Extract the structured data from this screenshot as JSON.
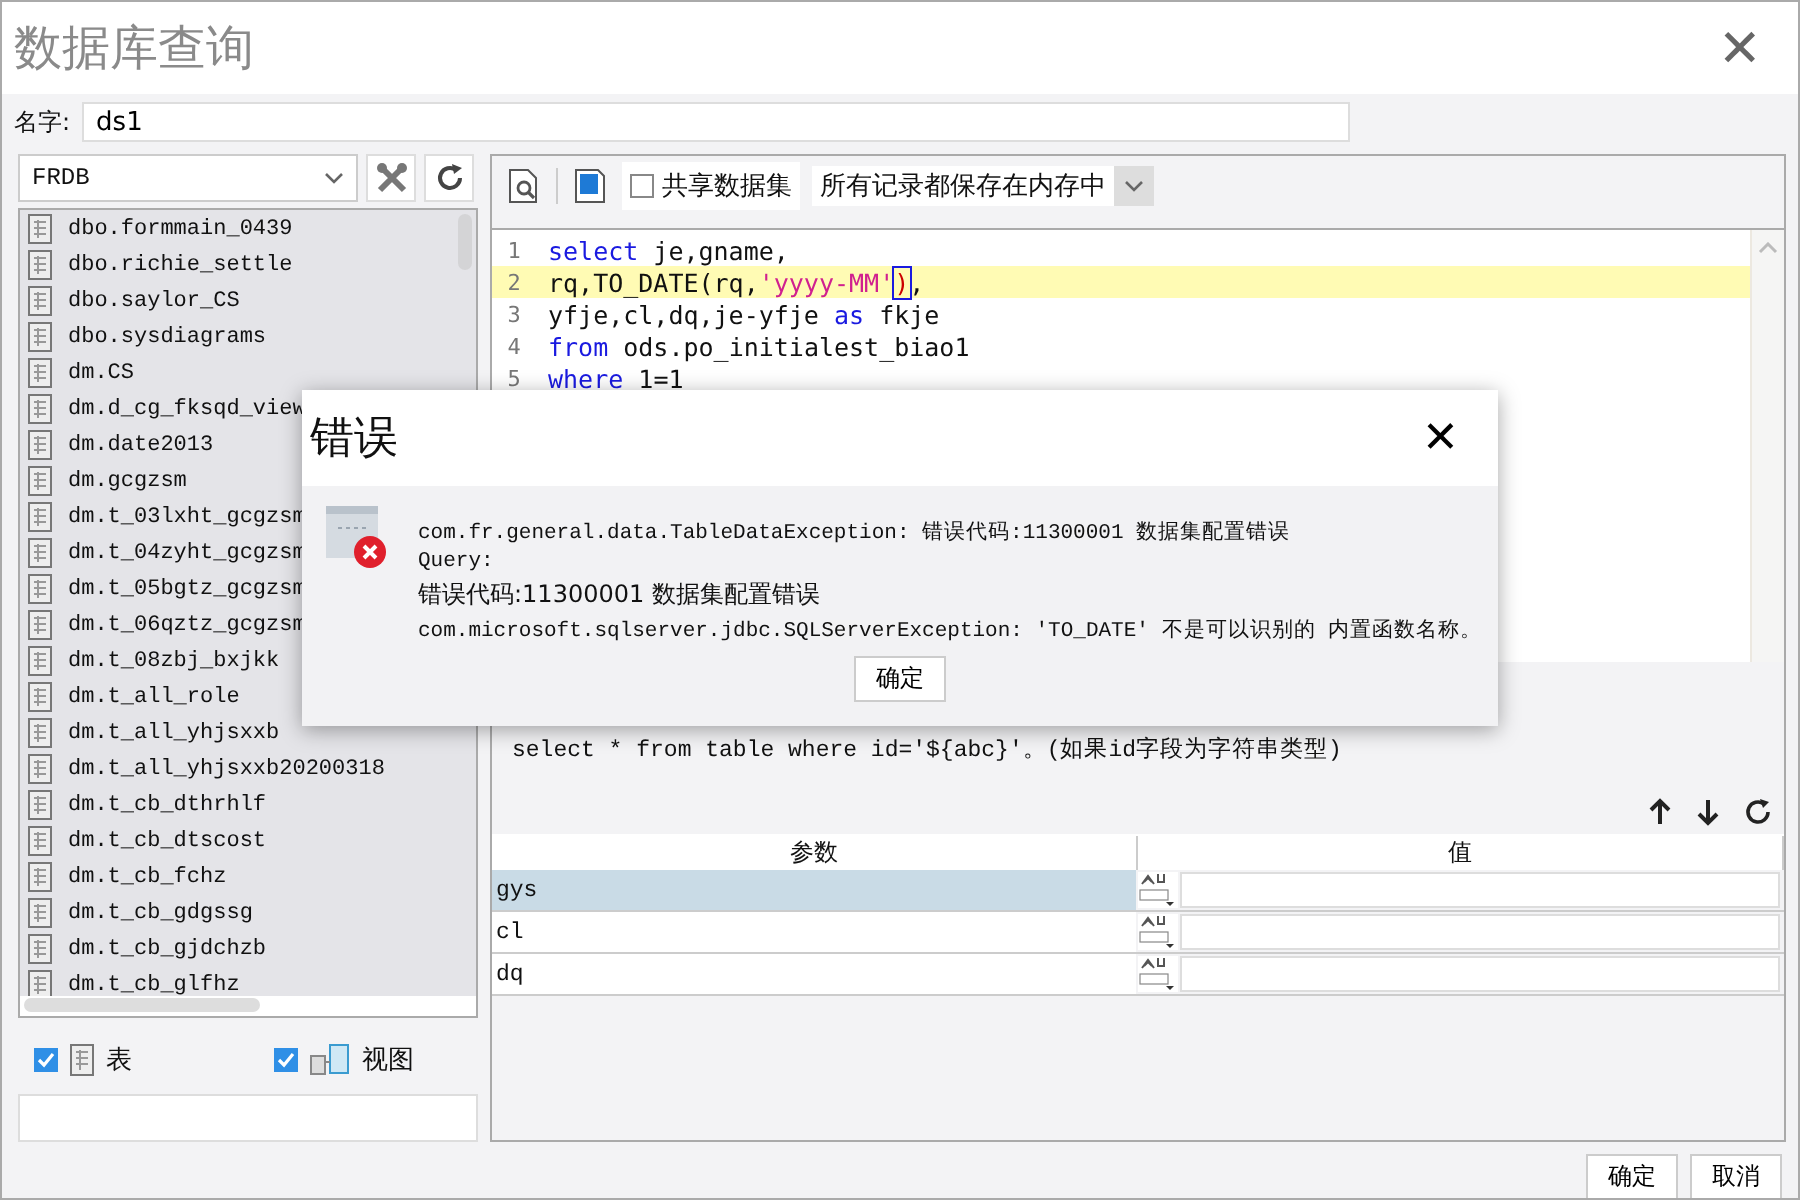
{
  "window": {
    "title": "数据库查询",
    "close": "✕"
  },
  "name_field": {
    "label": "名字:",
    "value": "ds1"
  },
  "connection": {
    "value": "FRDB"
  },
  "tables": [
    {
      "name": "dbo.formmain_0439"
    },
    {
      "name": "dbo.richie_settle"
    },
    {
      "name": "dbo.saylor_CS"
    },
    {
      "name": "dbo.sysdiagrams"
    },
    {
      "name": "dm.CS"
    },
    {
      "name": "dm.d_cg_fksqd_view"
    },
    {
      "name": "dm.date2013"
    },
    {
      "name": "dm.gcgzsm"
    },
    {
      "name": "dm.t_03lxht_gcgzsm"
    },
    {
      "name": "dm.t_04zyht_gcgzsm"
    },
    {
      "name": "dm.t_05bgtz_gcgzsm"
    },
    {
      "name": "dm.t_06qztz_gcgzsm"
    },
    {
      "name": "dm.t_08zbj_bxjkk"
    },
    {
      "name": "dm.t_all_role"
    },
    {
      "name": "dm.t_all_yhjsxxb"
    },
    {
      "name": "dm.t_all_yhjsxxb20200318"
    },
    {
      "name": "dm.t_cb_dthrhlf"
    },
    {
      "name": "dm.t_cb_dtscost"
    },
    {
      "name": "dm.t_cb_fchz"
    },
    {
      "name": "dm.t_cb_gdgssg"
    },
    {
      "name": "dm.t_cb_gjdchzb"
    },
    {
      "name": "dm.t_cb_glfhz"
    }
  ],
  "filters": [
    {
      "label": "表",
      "checked": true,
      "kind": "table"
    },
    {
      "label": "视图",
      "checked": true,
      "kind": "view"
    }
  ],
  "toolbar": {
    "share": {
      "label": "共享数据集",
      "checked": false
    },
    "storage": "所有记录都保存在内存中"
  },
  "editor": {
    "lines": [
      {
        "number": "1",
        "current": false,
        "tokens": [
          {
            "text": "select",
            "kind": "keyword"
          },
          {
            "text": " je,gname,",
            "kind": "plain"
          }
        ]
      },
      {
        "number": "2",
        "current": true,
        "tokens": [
          {
            "text": "rq,TO_DATE(rq,",
            "kind": "plain"
          },
          {
            "text": "'yyyy-MM'",
            "kind": "string"
          },
          {
            "text": ")",
            "kind": "bracket"
          },
          {
            "text": ",",
            "kind": "plain"
          }
        ]
      },
      {
        "number": "3",
        "current": false,
        "tokens": [
          {
            "text": "yfje,cl,dq,je-yfje ",
            "kind": "plain"
          },
          {
            "text": "as",
            "kind": "keyword"
          },
          {
            "text": " fkje",
            "kind": "plain"
          }
        ]
      },
      {
        "number": "4",
        "current": false,
        "tokens": [
          {
            "text": "from",
            "kind": "keyword"
          },
          {
            "text": " ods.po_initialest_biao1",
            "kind": "plain"
          }
        ]
      },
      {
        "number": "5",
        "current": false,
        "tokens": [
          {
            "text": "where",
            "kind": "keyword"
          },
          {
            "text": " 1=1",
            "kind": "plain"
          }
        ]
      }
    ]
  },
  "hint": "select * from table where id='${abc}'。(如果id字段为字符串类型)",
  "params": {
    "columns": [
      "参数",
      "值"
    ],
    "rows": [
      {
        "name": "gys",
        "selected": true
      },
      {
        "name": "cl",
        "selected": false
      },
      {
        "name": "dq",
        "selected": false
      }
    ]
  },
  "buttons": [
    "确定",
    "取消"
  ],
  "dialog": {
    "title": "错误",
    "close": "✕",
    "lines": [
      {
        "text": "com.fr.general.data.TableDataException: 错误代码:11300001 数据集配置错误",
        "kind": "mono"
      },
      {
        "text": "Query:",
        "kind": "mono"
      },
      {
        "text": "错误代码:11300001 数据集配置错误",
        "kind": "plain"
      },
      {
        "text": "com.microsoft.sqlserver.jdbc.SQLServerException: 'TO_DATE' 不是可以识别的 内置函数名称。",
        "kind": "mono"
      }
    ],
    "button": "确定"
  }
}
